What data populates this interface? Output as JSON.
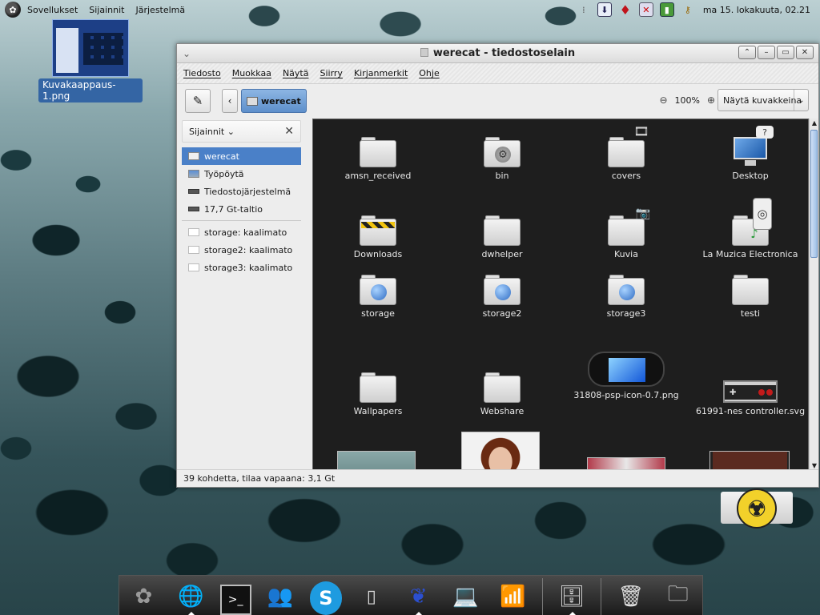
{
  "top_panel": {
    "menus": [
      "Sovellukset",
      "Sijainnit",
      "Järjestelmä"
    ],
    "clock": "ma 15. lokakuuta, 02.21"
  },
  "desktop": {
    "selected_icon_label": "Kuvakaappaus-1.png"
  },
  "window": {
    "title": "werecat - tiedostoselain",
    "menubar": [
      "Tiedosto",
      "Muokkaa",
      "Näytä",
      "Siirry",
      "Kirjanmerkit",
      "Ohje"
    ],
    "path_button": "werecat",
    "zoom_level": "100%",
    "view_mode": "Näytä kuvakkeina",
    "sidebar": {
      "header": "Sijainnit",
      "places": [
        {
          "label": "werecat",
          "icon": "home-icon",
          "selected": true
        },
        {
          "label": "Työpöytä",
          "icon": "desktop-icon",
          "selected": false
        },
        {
          "label": "Tiedostojärjestelmä",
          "icon": "drive-icon",
          "selected": false
        },
        {
          "label": "17,7 Gt-taltio",
          "icon": "drive-icon",
          "selected": false
        }
      ],
      "network": [
        {
          "label": "storage: kaalimato",
          "icon": "network-share-icon"
        },
        {
          "label": "storage2: kaalimato",
          "icon": "network-share-icon"
        },
        {
          "label": "storage3: kaalimato",
          "icon": "network-share-icon"
        }
      ]
    },
    "files": [
      {
        "name": "amsn_received",
        "icon": "folder-icon"
      },
      {
        "name": "bin",
        "icon": "folder-gear-icon"
      },
      {
        "name": "covers",
        "icon": "folder-video-icon"
      },
      {
        "name": "Desktop",
        "icon": "desktop-monitor-icon"
      },
      {
        "name": "Downloads",
        "icon": "folder-downloads-icon"
      },
      {
        "name": "dwhelper",
        "icon": "folder-icon"
      },
      {
        "name": "Kuvia",
        "icon": "folder-camera-icon"
      },
      {
        "name": "La Muzica Electronica",
        "icon": "folder-music-icon"
      },
      {
        "name": "storage",
        "icon": "folder-network-icon"
      },
      {
        "name": "storage2",
        "icon": "folder-network-icon"
      },
      {
        "name": "storage3",
        "icon": "folder-network-icon"
      },
      {
        "name": "testi",
        "icon": "folder-icon"
      },
      {
        "name": "Wallpapers",
        "icon": "folder-icon"
      },
      {
        "name": "Webshare",
        "icon": "folder-icon"
      },
      {
        "name": "31808-psp-icon-0.7.png",
        "icon": "psp-image-icon"
      },
      {
        "name": "61991-nes controller.svg",
        "icon": "nes-controller-image-icon"
      }
    ],
    "status": "39 kohdetta, tilaa vapaana: 3,1 Gt"
  },
  "dock": {
    "items": [
      "gnome-foot-icon",
      "globe-browser-icon",
      "terminal-icon",
      "messenger-icon",
      "skype-icon",
      "ipod-icon",
      "pidgin-icon",
      "laptop-icon",
      "network-wireless-icon",
      "file-cabinet-icon",
      "trash-icon",
      "folder-icon"
    ]
  },
  "colors": {
    "selection": "#4a80c8",
    "icon_view_bg": "#1e1e1e",
    "label_selected_bg": "#3465a4"
  }
}
